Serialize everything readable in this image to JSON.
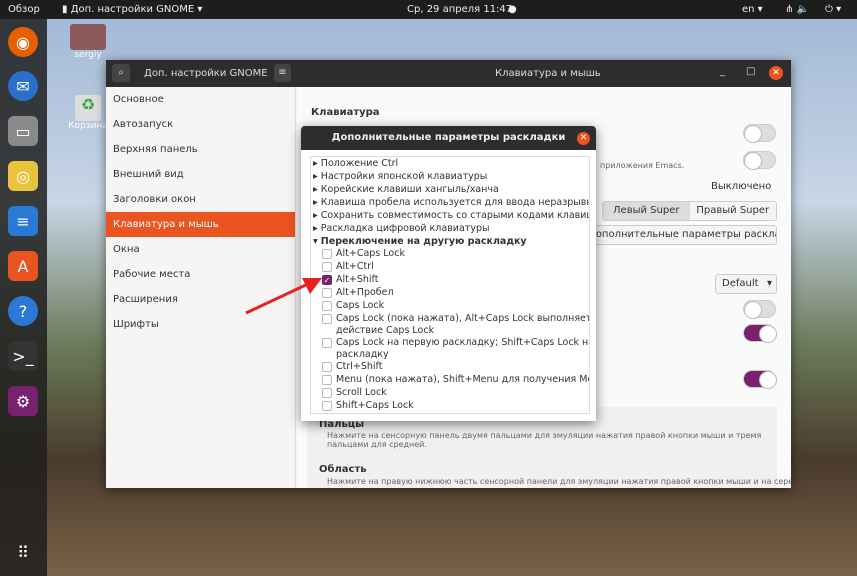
{
  "topbar": {
    "overview": "Обзор",
    "app": "Доп. настройки GNOME ▾",
    "clock": "Ср, 29 апреля  11:47",
    "lang": "en ▾",
    "system": "⏻ ▾"
  },
  "desktop": {
    "home": "sergiy",
    "trash": "Корзина"
  },
  "window": {
    "left_title": "Доп. настройки GNOME",
    "title": "Клавиатура и мышь"
  },
  "sidebar": [
    "Основное",
    "Автозапуск",
    "Верхняя панель",
    "Внешний вид",
    "Заголовки окон",
    "Клавиатура и мышь",
    "Окна",
    "Рабочие места",
    "Расширения",
    "Шрифты"
  ],
  "main": {
    "section": "Клавиатура",
    "emacs": "приложения Emacs.",
    "off": "Выключено",
    "left_super": "Левый Super",
    "right_super": "Правый Super",
    "adv_button": "Дополнительные параметры раскладки",
    "default": "Default",
    "fingers_title": "Пальцы",
    "fingers_desc": "Нажмите на сенсорную панель двумя пальцами для эмуляции нажатия правой кнопки мыши и тремя пальцами для средней.",
    "area_title": "Область",
    "area_desc": "Нажмите на правую нижнюю часть сенсорной панели для эмуляции нажатия правой кнопки мыши и на середину"
  },
  "dialog": {
    "title": "Дополнительные параметры раскладки",
    "groups": [
      "Положение Ctrl",
      "Настройки японской клавиатуры",
      "Корейские клавиши хангыль/ханча",
      "Клавиша пробела используется для ввода неразрывного п",
      "Сохранить совместимость со старыми кодами клавиш Sola",
      "Раскладка цифровой клавиатуры"
    ],
    "open_group": "Переключение на другую раскладку",
    "options": [
      {
        "label": "Alt+Caps Lock",
        "checked": false
      },
      {
        "label": "Alt+Ctrl",
        "checked": false
      },
      {
        "label": "Alt+Shift",
        "checked": true
      },
      {
        "label": "Alt+Пробел",
        "checked": false
      },
      {
        "label": "Caps Lock",
        "checked": false
      },
      {
        "label": "Caps Lock (пока нажата), Alt+Caps Lock выполняет обыч\nдействие Caps Lock",
        "checked": false
      },
      {
        "label": "Caps Lock на первую раскладку; Shift+Caps Lock на посл\nраскладку",
        "checked": false
      },
      {
        "label": "Ctrl+Shift",
        "checked": false
      },
      {
        "label": "Menu (пока нажата), Shift+Menu для получения Menu",
        "checked": false
      },
      {
        "label": "Scroll Lock",
        "checked": false
      },
      {
        "label": "Shift+Caps Lock",
        "checked": false
      }
    ]
  }
}
